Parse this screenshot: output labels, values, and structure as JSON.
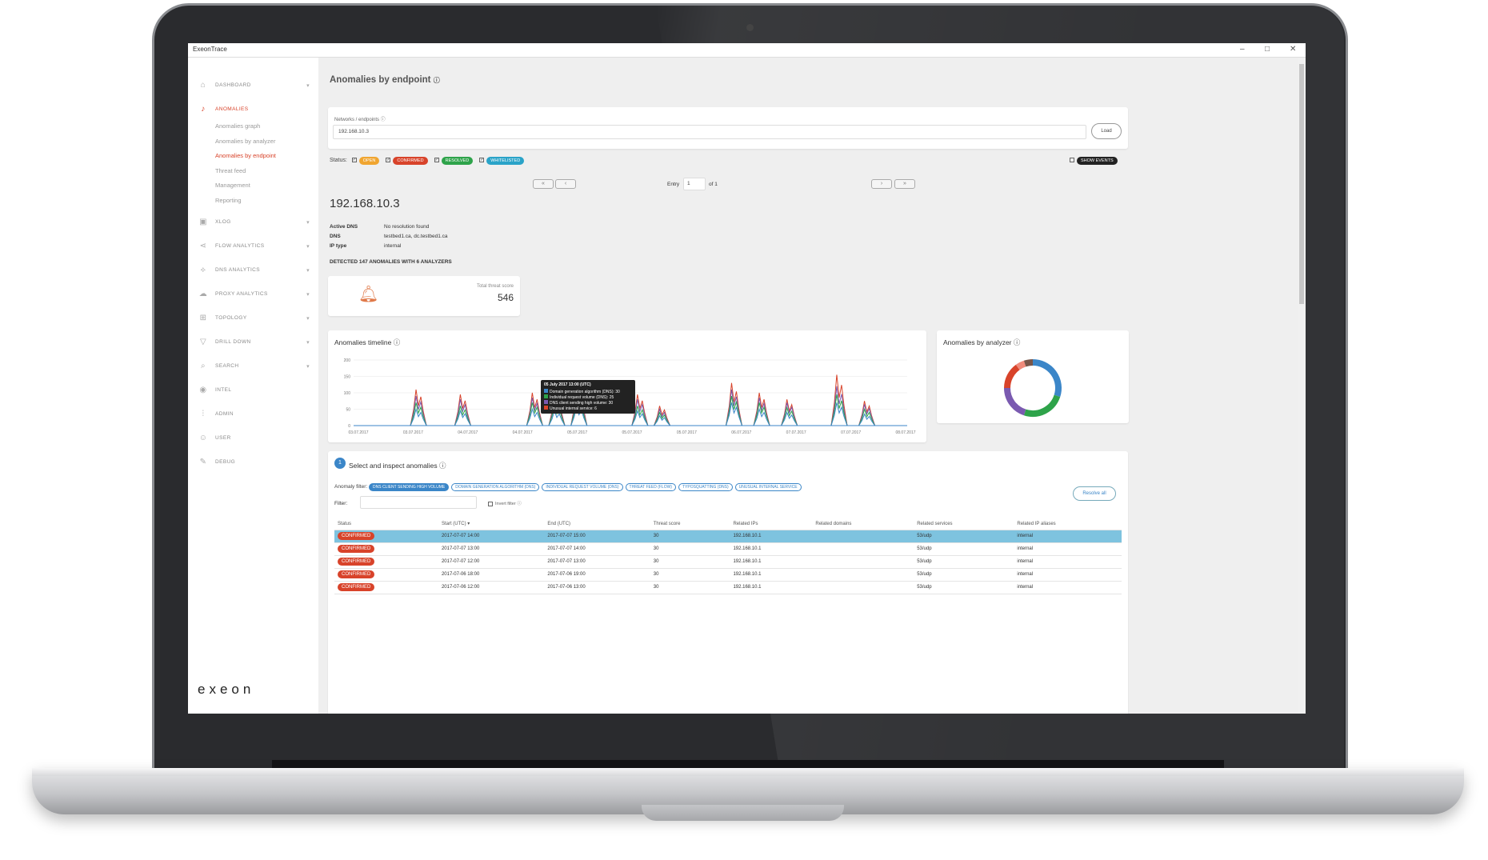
{
  "window": {
    "title": "ExeonTrace"
  },
  "sidebar": {
    "items": [
      {
        "label": "DASHBOARD",
        "icon": "home-icon"
      },
      {
        "label": "ANOMALIES",
        "icon": "bell-icon"
      },
      {
        "label": "XLOG",
        "icon": "box-icon"
      },
      {
        "label": "FLOW ANALYTICS",
        "icon": "share-icon"
      },
      {
        "label": "DNS ANALYTICS",
        "icon": "graph-icon"
      },
      {
        "label": "PROXY ANALYTICS",
        "icon": "cloud-icon"
      },
      {
        "label": "TOPOLOGY",
        "icon": "sitemap-icon"
      },
      {
        "label": "DRILL DOWN",
        "icon": "funnel-icon"
      },
      {
        "label": "SEARCH",
        "icon": "search-icon"
      },
      {
        "label": "INTEL",
        "icon": "eye-icon"
      },
      {
        "label": "ADMIN",
        "icon": "sliders-icon"
      },
      {
        "label": "USER",
        "icon": "user-icon"
      },
      {
        "label": "DEBUG",
        "icon": "wrench-icon"
      }
    ],
    "sub_items": [
      "Anomalies graph",
      "Anomalies by analyzer",
      "Anomalies by endpoint",
      "Threat feed",
      "Management",
      "Reporting"
    ],
    "logo": "exeon"
  },
  "page": {
    "title": "Anomalies by endpoint",
    "networks_label": "Networks / endpoints",
    "endpoint_value": "192.168.10.3",
    "load_label": "Load",
    "status_label": "Status:",
    "statuses": [
      {
        "label": "OPEN",
        "color": "#f0a530"
      },
      {
        "label": "CONFIRMED",
        "color": "#d8432a"
      },
      {
        "label": "RESOLVED",
        "color": "#2ea34a"
      },
      {
        "label": "WHITELISTED",
        "color": "#2aa3c8"
      }
    ],
    "show_events": "SHOW EVENTS",
    "entry_label": "Entry",
    "entry_value": "1",
    "entry_of": "of 1",
    "ip": "192.168.10.3",
    "active_dns_key": "Active DNS",
    "active_dns_val": "No resolution found",
    "dns_key": "DNS",
    "dns_val": "testbed1.ca, dc.testbed1.ca",
    "iptype_key": "IP type",
    "iptype_val": "internal",
    "detected": "DETECTED 147 ANOMALIES WITH 6 ANALYZERS",
    "threat_label": "Total threat score",
    "threat_value": "546"
  },
  "timeline": {
    "title": "Anomalies timeline",
    "tooltip": {
      "title": "05 July 2017 13:00 (UTC)",
      "lines": [
        {
          "text": "Domain generation algorithm (DNS): 30",
          "color": "#3b86c8"
        },
        {
          "text": "Individual request volume (DNS): 25",
          "color": "#2ea34a"
        },
        {
          "text": "DNS client sending high volume: 30",
          "color": "#7a5ab0"
        },
        {
          "text": "Unusual internal service: 6",
          "color": "#d8432a"
        }
      ]
    }
  },
  "chart_data": {
    "type": "line",
    "yticks": [
      "200",
      "150",
      "100",
      "50",
      "0"
    ],
    "ylim": [
      0,
      200
    ],
    "xticks": [
      "03.07.2017",
      "03.07.2017",
      "04.07.2017",
      "04.07.2017",
      "05.07.2017",
      "05.07.2017",
      "05.07.2017",
      "06.07.2017",
      "07.07.2017",
      "07.07.2017",
      "08.07.2017"
    ],
    "series": [
      {
        "color": "#d8432a",
        "peaks": [
          [
            0.12,
            110
          ],
          [
            0.2,
            95
          ],
          [
            0.33,
            100
          ],
          [
            0.37,
            95
          ],
          [
            0.41,
            120
          ],
          [
            0.52,
            95
          ],
          [
            0.56,
            60
          ],
          [
            0.69,
            130
          ],
          [
            0.74,
            100
          ],
          [
            0.79,
            80
          ],
          [
            0.88,
            155
          ],
          [
            0.93,
            75
          ]
        ]
      },
      {
        "color": "#7a5ab0",
        "peaks": [
          [
            0.12,
            90
          ],
          [
            0.2,
            80
          ],
          [
            0.33,
            85
          ],
          [
            0.37,
            80
          ],
          [
            0.41,
            100
          ],
          [
            0.52,
            80
          ],
          [
            0.56,
            50
          ],
          [
            0.69,
            110
          ],
          [
            0.74,
            85
          ],
          [
            0.79,
            70
          ],
          [
            0.88,
            120
          ],
          [
            0.93,
            65
          ]
        ]
      },
      {
        "color": "#2ea34a",
        "peaks": [
          [
            0.12,
            70
          ],
          [
            0.2,
            60
          ],
          [
            0.33,
            70
          ],
          [
            0.37,
            65
          ],
          [
            0.41,
            80
          ],
          [
            0.52,
            60
          ],
          [
            0.56,
            40
          ],
          [
            0.69,
            90
          ],
          [
            0.74,
            70
          ],
          [
            0.79,
            55
          ],
          [
            0.88,
            95
          ],
          [
            0.93,
            50
          ]
        ]
      },
      {
        "color": "#3b86c8",
        "peaks": [
          [
            0.12,
            50
          ],
          [
            0.2,
            45
          ],
          [
            0.33,
            50
          ],
          [
            0.37,
            45
          ],
          [
            0.41,
            60
          ],
          [
            0.52,
            45
          ],
          [
            0.56,
            30
          ],
          [
            0.69,
            70
          ],
          [
            0.74,
            50
          ],
          [
            0.79,
            40
          ],
          [
            0.88,
            70
          ],
          [
            0.93,
            35
          ]
        ]
      }
    ]
  },
  "donut": {
    "title": "Anomalies by analyzer",
    "segments": [
      {
        "value": 30,
        "color": "#3b86c8"
      },
      {
        "value": 25,
        "color": "#2ea34a"
      },
      {
        "value": 20,
        "color": "#7a5ab0"
      },
      {
        "value": 15,
        "color": "#d8432a"
      },
      {
        "value": 5,
        "color": "#f08a7a"
      },
      {
        "value": 5,
        "color": "#795548"
      }
    ]
  },
  "inspect": {
    "step": "1",
    "title": "Select and inspect anomalies",
    "filter_label": "Anomaly filter:",
    "filters": [
      "DNS CLIENT SENDING HIGH VOLUME",
      "DOMAIN GENERATION ALGORITHM (DNS)",
      "INDIVIDUAL REQUEST VOLUME (DNS)",
      "THREAT FEED (FLOW)",
      "TYPOSQUATTING (DNS)",
      "UNUSUAL INTERNAL SERVICE"
    ],
    "text_filter_label": "Filter:",
    "invert_label": "Invert filter",
    "resolve_all": "Resolve all",
    "columns": [
      "Status",
      "Start (UTC) ▾",
      "End (UTC)",
      "Threat score",
      "Related IPs",
      "Related domains",
      "Related services",
      "Related IP aliases"
    ],
    "rows": [
      [
        "CONFIRMED",
        "2017-07-07 14:00",
        "2017-07-07 15:00",
        "30",
        "192.168.10.1",
        "",
        "53/udp",
        "internal"
      ],
      [
        "CONFIRMED",
        "2017-07-07 13:00",
        "2017-07-07 14:00",
        "30",
        "192.168.10.1",
        "",
        "53/udp",
        "internal"
      ],
      [
        "CONFIRMED",
        "2017-07-07 12:00",
        "2017-07-07 13:00",
        "30",
        "192.168.10.1",
        "",
        "53/udp",
        "internal"
      ],
      [
        "CONFIRMED",
        "2017-07-06 18:00",
        "2017-07-06 19:00",
        "30",
        "192.168.10.1",
        "",
        "53/udp",
        "internal"
      ],
      [
        "CONFIRMED",
        "2017-07-06 12:00",
        "2017-07-06 13:00",
        "30",
        "192.168.10.1",
        "",
        "53/udp",
        "internal"
      ]
    ]
  }
}
